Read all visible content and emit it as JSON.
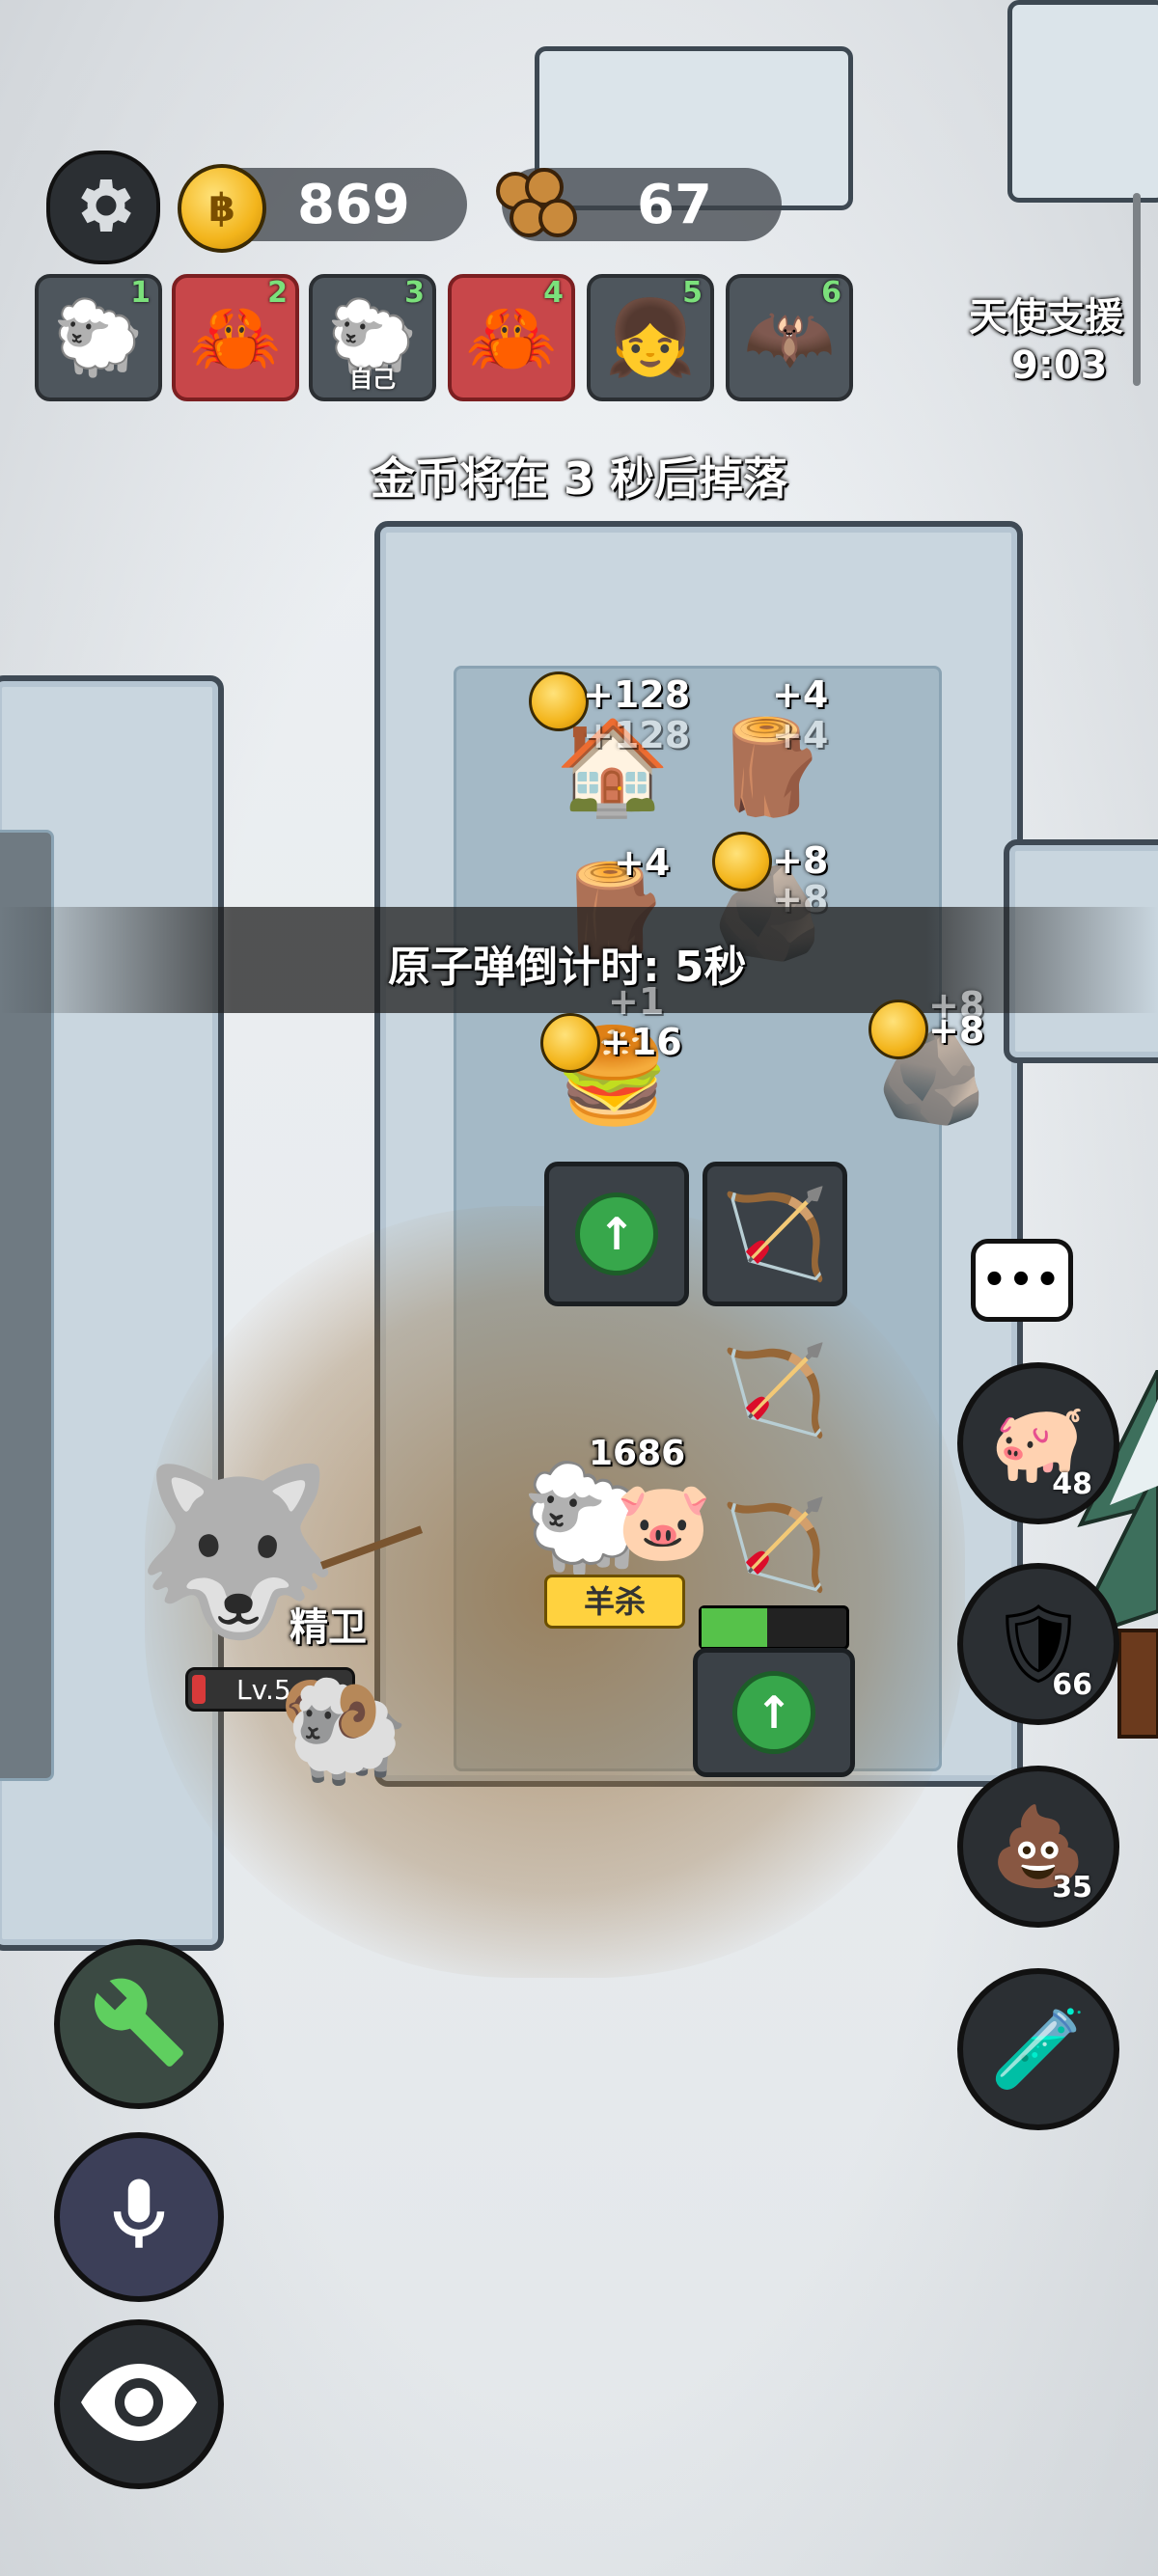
{
  "hud": {
    "gold": "869",
    "wood": "67",
    "angel_support_label": "天使支援",
    "angel_support_time": "9:03"
  },
  "players": [
    {
      "num": "1",
      "avatar": "sheep-icon",
      "enemy": false,
      "sub": ""
    },
    {
      "num": "2",
      "avatar": "claw-icon",
      "enemy": true,
      "sub": ""
    },
    {
      "num": "3",
      "avatar": "sheep-icon",
      "enemy": false,
      "sub": "自己"
    },
    {
      "num": "4",
      "avatar": "claw-icon",
      "enemy": true,
      "sub": ""
    },
    {
      "num": "5",
      "avatar": "red-hood-icon",
      "enemy": false,
      "sub": ""
    },
    {
      "num": "6",
      "avatar": "bat-mask-icon",
      "enemy": false,
      "sub": ""
    }
  ],
  "messages": {
    "gold_drop": "金币将在 3 秒后掉落",
    "nuke_countdown": "原子弹倒计时: 5秒"
  },
  "gains": {
    "house_gold": "+128",
    "house_gold_ghost": "+128",
    "lumber1": "+4",
    "lumber1_ghost": "+4",
    "lumber2": "+4",
    "ore1": "+8",
    "ore1_ghost": "+8",
    "burger": "+16",
    "burger_ghost": "+1",
    "ore2": "+8",
    "ore2_ghost": "+8"
  },
  "units": {
    "sheep_hp": "1686",
    "sheep_tag": "羊杀",
    "guard_name": "精卫",
    "guard_level": "Lv.5"
  },
  "right_buttons": {
    "piggy": "48",
    "shield": "66",
    "poop": "35"
  },
  "colors": {
    "gold": "#f3b51c",
    "upgrade_green": "#37a74b",
    "enemy_red": "#c8474a",
    "panel_dark": "#2b2f33"
  }
}
